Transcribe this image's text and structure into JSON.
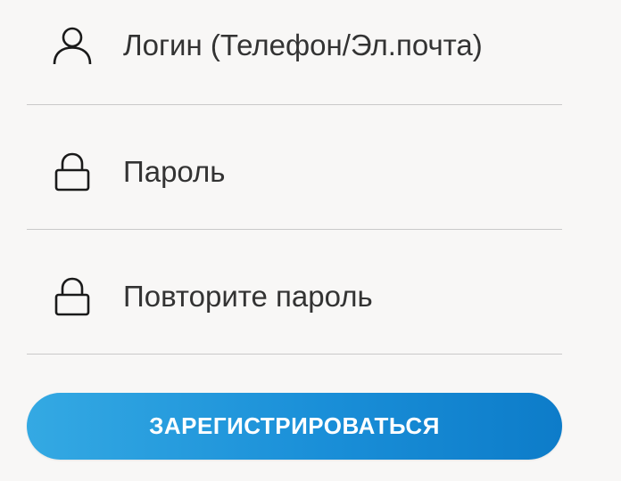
{
  "form": {
    "login": {
      "icon": "user-icon",
      "value": "",
      "placeholder": "Логин (Телефон/Эл.почта)"
    },
    "password": {
      "icon": "lock-icon",
      "value": "",
      "placeholder": "Пароль"
    },
    "password_repeat": {
      "icon": "lock-icon",
      "value": "",
      "placeholder": "Повторите пароль"
    },
    "submit_label": "ЗАРЕГИСТРИРОВАТЬСЯ"
  },
  "colors": {
    "background": "#f8f7f6",
    "divider": "#c9c9c9",
    "text": "#333333",
    "button_gradient_start": "#34a9e3",
    "button_gradient_end": "#0d7cc9",
    "button_text": "#ffffff"
  }
}
